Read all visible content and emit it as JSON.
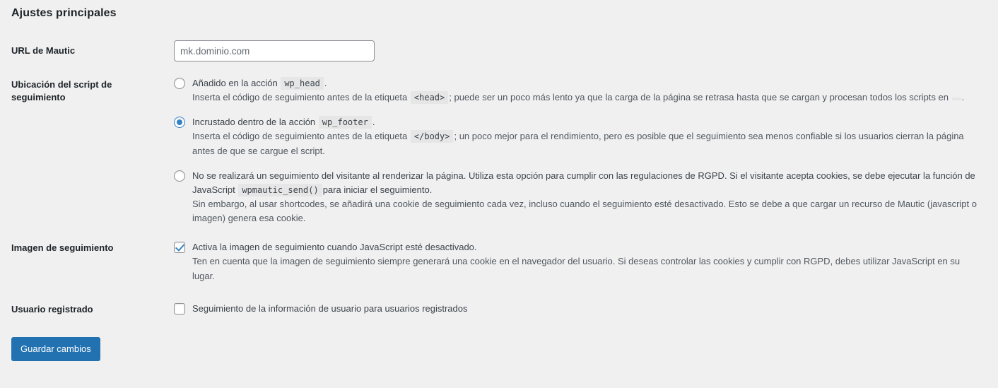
{
  "section": {
    "title": "Ajustes principales"
  },
  "fields": {
    "url": {
      "label": "URL de Mautic",
      "input_value": "",
      "input_placeholder": "mk.dominio.com"
    },
    "script_location": {
      "label": "Ubicación del script de seguimiento",
      "options": [
        {
          "id": "wp_head",
          "checked": false,
          "label_before": "Añadido en la acción",
          "code": "wp_head",
          "label_after": ".",
          "desc_before": "Inserta el código de seguimiento antes de la etiqueta",
          "desc_code": "<head>",
          "desc_middle": "; puede ser un poco más lento ya que la carga de la página se retrasa hasta que se cargan y procesan todos los scripts en",
          "desc_code2": "",
          "desc_after": "."
        },
        {
          "id": "wp_footer",
          "checked": true,
          "label_before": "Incrustado dentro de la acción",
          "code": "wp_footer",
          "label_after": ".",
          "desc_before": "Inserta el código de seguimiento antes de la etiqueta",
          "desc_code": "</body>",
          "desc_middle": "; un poco mejor para el rendimiento, pero es posible que el seguimiento sea menos confiable si los usuarios cierran la página antes de que se cargue el script.",
          "desc_code2": "",
          "desc_after": ""
        },
        {
          "id": "no_tracking",
          "checked": false,
          "label_before": "No se realizará un seguimiento del visitante al renderizar la página. Utiliza esta opción para cumplir con las regulaciones de RGPD. Si el visitante acepta cookies, se debe ejecutar la función de JavaScript",
          "code": "wpmautic_send()",
          "label_after": "para iniciar el seguimiento.",
          "desc_before": "Sin embargo, al usar shortcodes, se añadirá una cookie de seguimiento cada vez, incluso cuando el seguimiento esté desactivado. Esto se debe a que cargar un recurso de Mautic (javascript o imagen) genera esa cookie.",
          "desc_code": "",
          "desc_middle": "",
          "desc_code2": "",
          "desc_after": ""
        }
      ]
    },
    "tracking_image": {
      "label": "Imagen de seguimiento",
      "checked": true,
      "checkbox_label": "Activa la imagen de seguimiento cuando JavaScript esté desactivado.",
      "description": "Ten en cuenta que la imagen de seguimiento siempre generará una cookie en el navegador del usuario. Si deseas controlar las cookies y cumplir con RGPD, debes utilizar JavaScript en su lugar."
    },
    "registered_user": {
      "label": "Usuario registrado",
      "checked": false,
      "checkbox_label": "Seguimiento de la información de usuario para usuarios registrados"
    }
  },
  "submit": {
    "label": "Guardar cambios"
  },
  "colors": {
    "background": "#f0f0f1",
    "accent": "#2271b1",
    "control_accent": "#3582c4",
    "heading": "#1d2327",
    "body_text": "#3c434a",
    "muted_text": "#50575e",
    "code_background": "#e6e6e6",
    "input_border": "#8c8f94"
  }
}
